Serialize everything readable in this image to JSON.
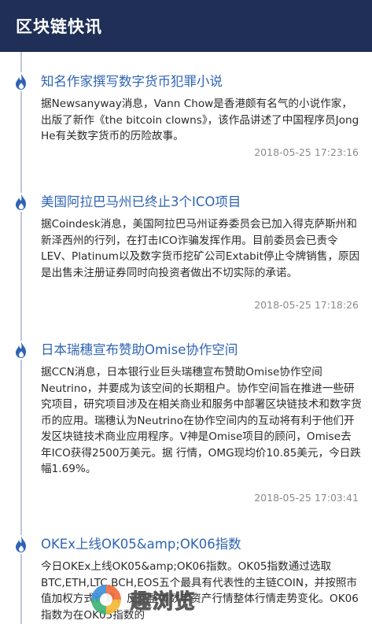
{
  "header": {
    "title": "区块链快讯"
  },
  "items": [
    {
      "title": "知名作家撰写数字货币犯罪小说",
      "body": "据Newsanyway消息，Vann Chow是香港颇有名气的小说作家，出版了新作《the bitcoin clowns》，该作品讲述了中国程序员Jong He有关数字货币的历险故事。",
      "time": "2018-05-25 17:23:16"
    },
    {
      "title": "美国阿拉巴马州已终止3个ICO项目",
      "body": "据Coindesk消息，美国阿拉巴马州证券委员会已加入得克萨斯州和新泽西州的行列，在打击ICO诈骗发挥作用。目前委员会已责令LEV、Platinum以及数字货币挖矿公司Extabit停止令牌销售，原因是出售未注册证券同时向投资者做出不切实际的承诺。",
      "time": "2018-05-25 17:18:26"
    },
    {
      "title": "日本瑞穗宣布赞助Omise协作空间",
      "body": "据CCN消息，日本银行业巨头瑞穗宣布赞助Omise协作空间Neutrino，并要成为该空间的长期租户。协作空间旨在推进一些研究项目，研究项目涉及在相关商业和服务中部署区块链技术和数字货币的应用。瑞穗认为Neutrino在协作空间内的互动将有利于他们开发区块链技术商业应用程序。V神是Omise项目的顾问，Omise去年ICO获得2500万美元。据 行情，OMG现均价10.85美元，今日跌幅1.69%。",
      "time": "2018-05-25 17:03:41"
    },
    {
      "title": "OKEx上线OK05&amp;OK06指数",
      "body": "今日OKEx上线OK05&amp;OK06指数。OK05指数通过选取BTC,ETH,LTC,BCH,EOS五个最具有代表性的主链COIN，并按照市值加权方式计算，反应整体数字资产行情整体行情走势变化。OK06指数为在OK05指数的"
    }
  ],
  "watermark": {
    "text": "趣浏览"
  },
  "colors": {
    "header_bg": "#1f2f57",
    "title": "#2f64b4",
    "flame": "#2f64b4"
  },
  "icons": {
    "item_marker": "flame-icon"
  }
}
